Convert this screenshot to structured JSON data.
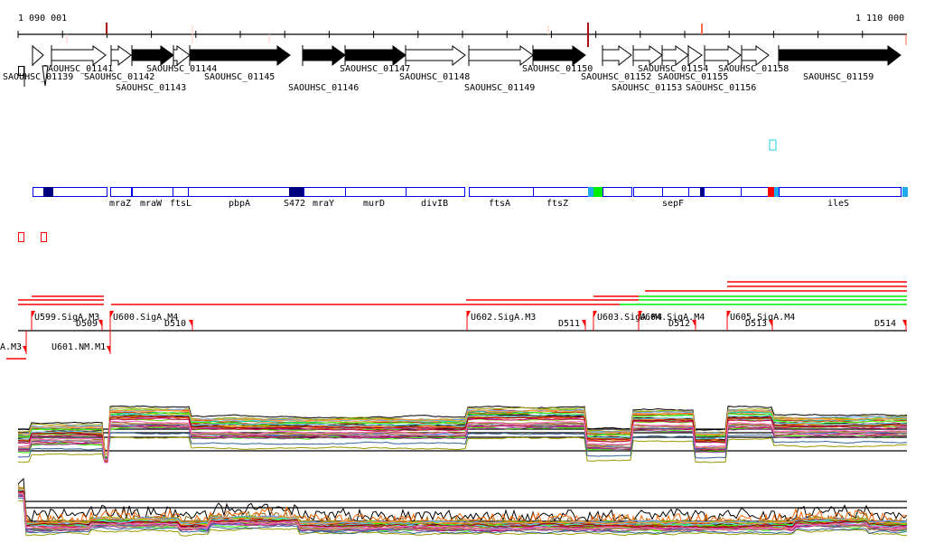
{
  "ruler": {
    "start_label": "1 090 001",
    "end_label": "1 110 000"
  },
  "genes": [
    {
      "name": "SAOUHSC_01139",
      "strand": "+",
      "filled": false
    },
    {
      "name": "SAOUHSC_01141",
      "strand": "+",
      "filled": false
    },
    {
      "name": "SAOUHSC_01142",
      "strand": "+",
      "filled": false
    },
    {
      "name": "SAOUHSC_01143",
      "strand": "+",
      "filled": true
    },
    {
      "name": "SAOUHSC_01144",
      "strand": "+",
      "filled": false
    },
    {
      "name": "SAOUHSC_01145",
      "strand": "+",
      "filled": true
    },
    {
      "name": "SAOUHSC_01146",
      "strand": "+",
      "filled": true
    },
    {
      "name": "SAOUHSC_01147",
      "strand": "+",
      "filled": true
    },
    {
      "name": "SAOUHSC_01148",
      "strand": "+",
      "filled": false
    },
    {
      "name": "SAOUHSC_01149",
      "strand": "+",
      "filled": false
    },
    {
      "name": "SAOUHSC_01150",
      "strand": "+",
      "filled": true
    },
    {
      "name": "SAOUHSC_01152",
      "strand": "+",
      "filled": false
    },
    {
      "name": "SAOUHSC_01153",
      "strand": "+",
      "filled": false
    },
    {
      "name": "SAOUHSC_01154",
      "strand": "+",
      "filled": false
    },
    {
      "name": "SAOUHSC_01155",
      "strand": "+",
      "filled": false
    },
    {
      "name": "SAOUHSC_01156",
      "strand": "+",
      "filled": false
    },
    {
      "name": "SAOUHSC_01158",
      "strand": "+",
      "filled": false
    },
    {
      "name": "SAOUHSC_01159",
      "strand": "+",
      "filled": true
    }
  ],
  "annotation_labels": [
    "mraZ",
    "mraW",
    "ftsL",
    "pbpA",
    "S472",
    "mraY",
    "murD",
    "divIB",
    "ftsA",
    "ftsZ",
    "sepF",
    "ileS"
  ],
  "promoters": [
    "U599.SigA.M3",
    "D509",
    "U600.SigA.M4",
    "D510",
    "U602.SigA.M3",
    "D511",
    "U603.SigA.M4",
    "U604.SigA.M4",
    "D512",
    "U605.SigA.M4",
    "D513",
    "D514",
    "A.M3",
    "U601.NM.M1"
  ],
  "colors": {
    "gene_box": "#0000ee",
    "dark_box": "#000080",
    "red": "#ff0000",
    "green": "#00ee00",
    "light_blue": "#22aaee"
  }
}
